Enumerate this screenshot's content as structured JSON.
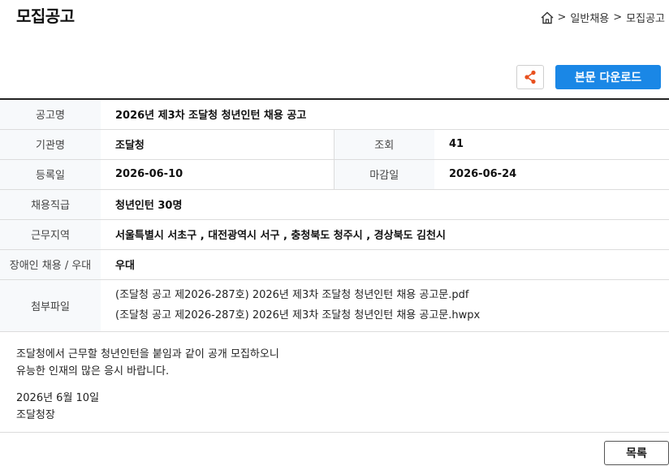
{
  "page": {
    "title": "모집공고"
  },
  "breadcrumb": {
    "sep1": ">",
    "item1": "일반채용",
    "sep2": ">",
    "item2": "모집공고"
  },
  "toolbar": {
    "share_icon": "share-icon",
    "download_label": "본문 다운로드"
  },
  "info": {
    "title_label": "공고명",
    "title_value": "2026년 제3차 조달청 청년인턴 채용 공고",
    "agency_label": "기관명",
    "agency_value": "조달청",
    "views_label": "조회",
    "views_value": "41",
    "reg_label": "등록일",
    "reg_value": "2026-06-10",
    "deadline_label": "마감일",
    "deadline_value": "2026-06-24",
    "position_label": "채용직급",
    "position_value": "청년인턴 30명",
    "region_label": "근무지역",
    "region_value": "서울특별시 서초구 , 대전광역시 서구 , 충청북도 청주시 , 경상북도 김천시",
    "disabled_label": "장애인 채용 / 우대",
    "disabled_value": "우대",
    "files_label": "첨부파일",
    "files": [
      "(조달청 공고 제2026-287호) 2026년 제3차 조달청 청년인턴 채용 공고문.pdf",
      "(조달청 공고 제2026-287호) 2026년 제3차 조달청 청년인턴 채용 공고문.hwpx"
    ]
  },
  "body": {
    "line1": "조달청에서 근무할 청년인턴을 붙임과 같이 공개 모집하오니",
    "line2": "유능한 인재의 많은 응시 바랍니다.",
    "date": "2026년 6월 10일",
    "signature": "조달청장"
  },
  "footer": {
    "list_label": "목록"
  }
}
